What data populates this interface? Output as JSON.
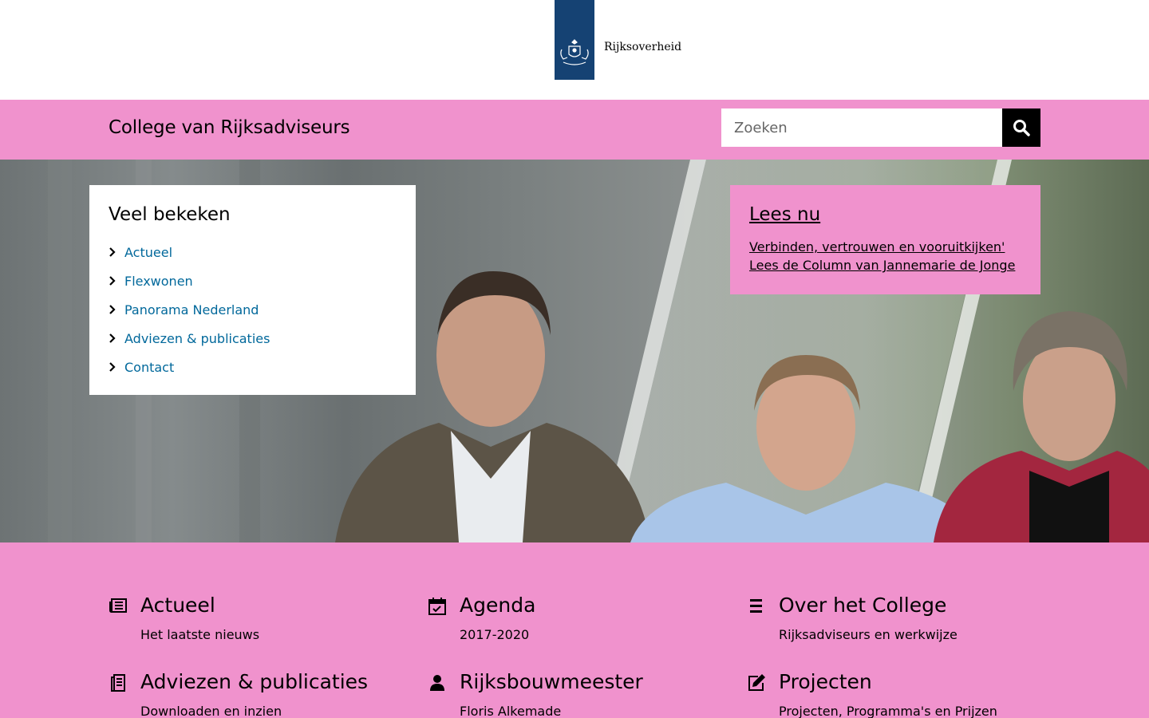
{
  "header": {
    "logo_text": "Rijksoverheid"
  },
  "sitebar": {
    "title": "College van Rijksadviseurs",
    "search_placeholder": "Zoeken",
    "search_icon": "search-icon"
  },
  "popular": {
    "title": "Veel bekeken",
    "items": [
      {
        "label": "Actueel"
      },
      {
        "label": "Flexwonen"
      },
      {
        "label": "Panorama Nederland"
      },
      {
        "label": "Adviezen & publicaties"
      },
      {
        "label": "Contact"
      }
    ]
  },
  "feature": {
    "title": "Lees nu",
    "link": "Verbinden, vertrouwen en vooruitkijken' Lees de Column van Jannemarie de Jonge"
  },
  "tiles": [
    {
      "icon": "newspaper-icon",
      "title": "Actueel",
      "subtitle": "Het laatste nieuws"
    },
    {
      "icon": "calendar-icon",
      "title": "Agenda",
      "subtitle": "2017-2020"
    },
    {
      "icon": "list-icon",
      "title": "Over het College",
      "subtitle": "Rijksadviseurs en werkwijze"
    },
    {
      "icon": "document-icon",
      "title": "Adviezen & publicaties",
      "subtitle": "Downloaden en inzien"
    },
    {
      "icon": "person-icon",
      "title": "Rijksbouwmeester",
      "subtitle": "Floris Alkemade"
    },
    {
      "icon": "edit-icon",
      "title": "Projecten",
      "subtitle": "Projecten, Programma's en Prijzen"
    }
  ],
  "colors": {
    "brand_pink": "#f092cd",
    "logo_blue": "#154273",
    "link_blue": "#01689b"
  }
}
